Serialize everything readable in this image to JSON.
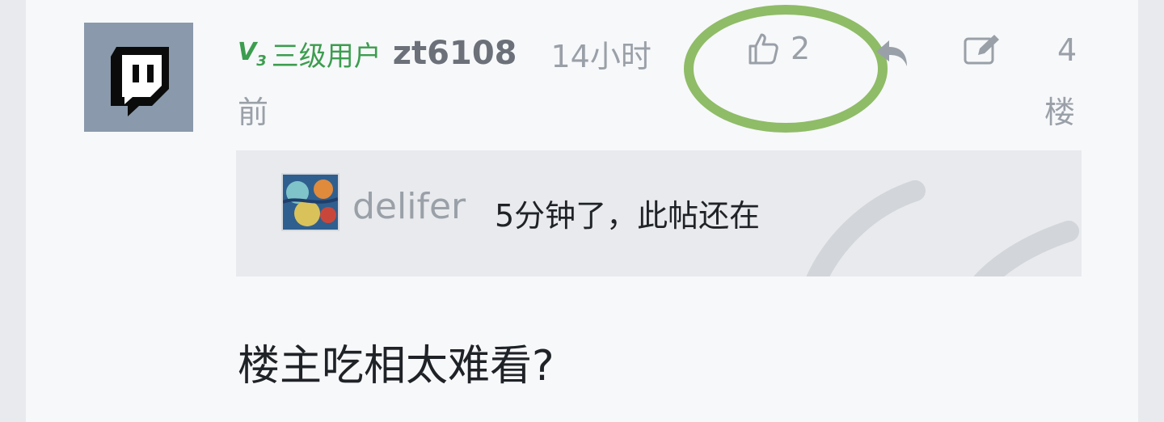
{
  "post": {
    "level_badge": "V",
    "level_badge_sub": "3",
    "level_text": "三级用户",
    "username": "zt6108",
    "time_part1": "14小时",
    "time_part2": "前",
    "like_count": "2",
    "floor_number": "4",
    "floor_suffix": "楼",
    "content": "楼主吃相太难看?"
  },
  "quote": {
    "username": "delifer",
    "text": "5分钟了，此帖还在"
  },
  "colors": {
    "level_green": "#3c9d4f",
    "highlight_green": "#8fbc67",
    "muted_gray": "#9aa0a8",
    "avatar_bg": "#8a99ab"
  },
  "icons": {
    "avatar": "twitch-logo-icon",
    "like": "thumbs-up-icon",
    "reply": "reply-arrow-icon",
    "edit": "edit-icon"
  }
}
